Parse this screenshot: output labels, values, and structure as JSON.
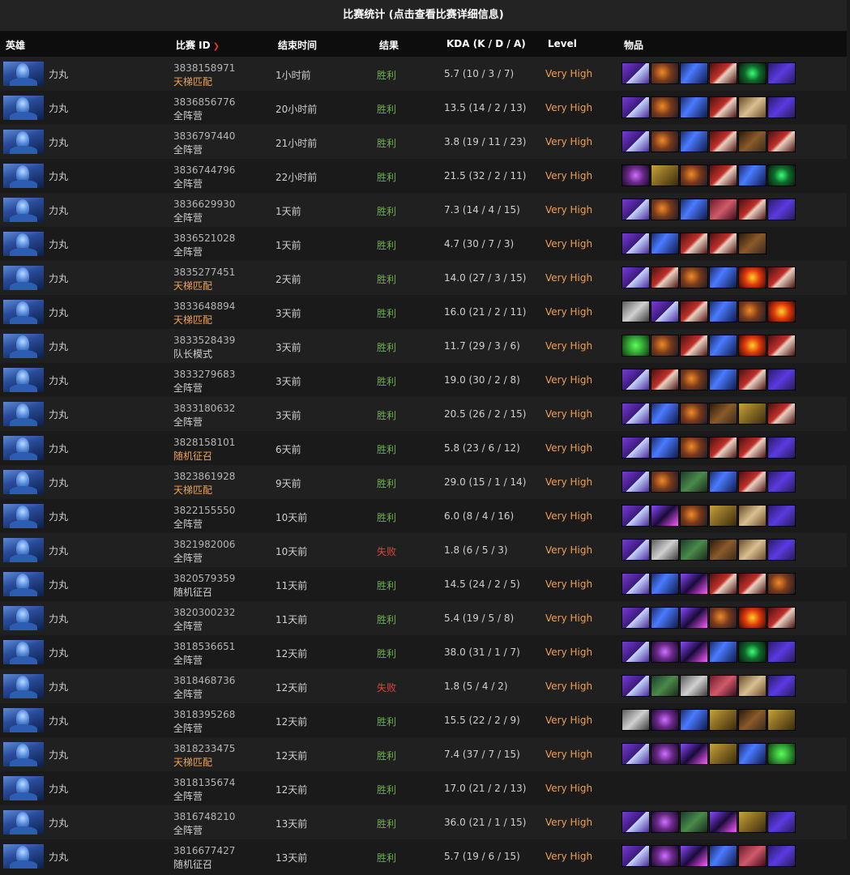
{
  "page_title": "比赛统计 (点击查看比赛详细信息)",
  "columns": {
    "hero": "英雄",
    "match_id": "比赛 ID",
    "end_time": "结束时间",
    "result": "结果",
    "kda": "KDA (K / D / A)",
    "level": "Level",
    "items": "物品"
  },
  "rows": [
    {
      "hero": "力丸",
      "match_id": "3838158971",
      "mode": "天梯匹配",
      "ranked": true,
      "end_time": "1小时前",
      "result": "胜利",
      "win": true,
      "kda": "5.7 (10 / 3 / 7)",
      "level": "Very High",
      "items": [
        "it-a",
        "it-b",
        "it-c",
        "it-d",
        "it-e",
        "it-f"
      ]
    },
    {
      "hero": "力丸",
      "match_id": "3836856776",
      "mode": "全阵营",
      "ranked": false,
      "end_time": "20小时前",
      "result": "胜利",
      "win": true,
      "kda": "13.5 (14 / 2 / 13)",
      "level": "Very High",
      "items": [
        "it-a",
        "it-b",
        "it-c",
        "it-d",
        "it-g",
        "it-f"
      ]
    },
    {
      "hero": "力丸",
      "match_id": "3836797440",
      "mode": "全阵营",
      "ranked": false,
      "end_time": "21小时前",
      "result": "胜利",
      "win": true,
      "kda": "3.8 (19 / 11 / 23)",
      "level": "Very High",
      "items": [
        "it-a",
        "it-b",
        "it-c",
        "it-d",
        "it-j",
        "it-d"
      ]
    },
    {
      "hero": "力丸",
      "match_id": "3836744796",
      "mode": "全阵营",
      "ranked": false,
      "end_time": "22小时前",
      "result": "胜利",
      "win": true,
      "kda": "21.5 (32 / 2 / 11)",
      "level": "Very High",
      "items": [
        "it-i",
        "it-l",
        "it-b",
        "it-d",
        "it-c",
        "it-e"
      ]
    },
    {
      "hero": "力丸",
      "match_id": "3836629930",
      "mode": "全阵营",
      "ranked": false,
      "end_time": "1天前",
      "result": "胜利",
      "win": true,
      "kda": "7.3 (14 / 4 / 15)",
      "level": "Very High",
      "items": [
        "it-a",
        "it-b",
        "it-c",
        "it-p",
        "it-d",
        "it-f"
      ]
    },
    {
      "hero": "力丸",
      "match_id": "3836521028",
      "mode": "全阵营",
      "ranked": false,
      "end_time": "1天前",
      "result": "胜利",
      "win": true,
      "kda": "4.7 (30 / 7 / 3)",
      "level": "Very High",
      "items": [
        "it-a",
        "it-c",
        "it-d",
        "it-d",
        "it-j"
      ]
    },
    {
      "hero": "力丸",
      "match_id": "3835277451",
      "mode": "天梯匹配",
      "ranked": true,
      "end_time": "2天前",
      "result": "胜利",
      "win": true,
      "kda": "14.0 (27 / 3 / 15)",
      "level": "Very High",
      "items": [
        "it-a",
        "it-d",
        "it-b",
        "it-c",
        "it-h",
        "it-d"
      ]
    },
    {
      "hero": "力丸",
      "match_id": "3833648894",
      "mode": "天梯匹配",
      "ranked": true,
      "end_time": "3天前",
      "result": "胜利",
      "win": true,
      "kda": "16.0 (21 / 2 / 11)",
      "level": "Very High",
      "items": [
        "it-n",
        "it-a",
        "it-d",
        "it-c",
        "it-b",
        "it-h"
      ]
    },
    {
      "hero": "力丸",
      "match_id": "3833528439",
      "mode": "队长模式",
      "ranked": false,
      "end_time": "3天前",
      "result": "胜利",
      "win": true,
      "kda": "11.7 (29 / 3 / 6)",
      "level": "Very High",
      "items": [
        "it-m",
        "it-b",
        "it-d",
        "it-c",
        "it-h",
        "it-d"
      ]
    },
    {
      "hero": "力丸",
      "match_id": "3833279683",
      "mode": "全阵营",
      "ranked": false,
      "end_time": "3天前",
      "result": "胜利",
      "win": true,
      "kda": "19.0 (30 / 2 / 8)",
      "level": "Very High",
      "items": [
        "it-a",
        "it-d",
        "it-b",
        "it-c",
        "it-d",
        "it-f"
      ]
    },
    {
      "hero": "力丸",
      "match_id": "3833180632",
      "mode": "全阵营",
      "ranked": false,
      "end_time": "3天前",
      "result": "胜利",
      "win": true,
      "kda": "20.5 (26 / 2 / 15)",
      "level": "Very High",
      "items": [
        "it-a",
        "it-c",
        "it-b",
        "it-j",
        "it-l",
        "it-d"
      ]
    },
    {
      "hero": "力丸",
      "match_id": "3828158101",
      "mode": "随机征召",
      "ranked": true,
      "end_time": "6天前",
      "result": "胜利",
      "win": true,
      "kda": "5.8 (23 / 6 / 12)",
      "level": "Very High",
      "items": [
        "it-a",
        "it-c",
        "it-b",
        "it-d",
        "it-d",
        "it-f"
      ]
    },
    {
      "hero": "力丸",
      "match_id": "3823861928",
      "mode": "天梯匹配",
      "ranked": true,
      "end_time": "9天前",
      "result": "胜利",
      "win": true,
      "kda": "29.0 (15 / 1 / 14)",
      "level": "Very High",
      "items": [
        "it-a",
        "it-b",
        "it-o",
        "it-c",
        "it-d",
        "it-f"
      ]
    },
    {
      "hero": "力丸",
      "match_id": "3822155550",
      "mode": "全阵营",
      "ranked": false,
      "end_time": "10天前",
      "result": "胜利",
      "win": true,
      "kda": "6.0 (8 / 4 / 16)",
      "level": "Very High",
      "items": [
        "it-a",
        "it-k",
        "it-b",
        "it-l",
        "it-g",
        "it-f"
      ]
    },
    {
      "hero": "力丸",
      "match_id": "3821982006",
      "mode": "全阵营",
      "ranked": false,
      "end_time": "10天前",
      "result": "失败",
      "win": false,
      "kda": "1.8 (6 / 5 / 3)",
      "level": "Very High",
      "items": [
        "it-a",
        "it-n",
        "it-o",
        "it-j",
        "it-g",
        "it-f"
      ]
    },
    {
      "hero": "力丸",
      "match_id": "3820579359",
      "mode": "随机征召",
      "ranked": false,
      "end_time": "11天前",
      "result": "胜利",
      "win": true,
      "kda": "14.5 (24 / 2 / 5)",
      "level": "Very High",
      "items": [
        "it-a",
        "it-c",
        "it-k",
        "it-d",
        "it-d",
        "it-b"
      ]
    },
    {
      "hero": "力丸",
      "match_id": "3820300232",
      "mode": "全阵营",
      "ranked": false,
      "end_time": "11天前",
      "result": "胜利",
      "win": true,
      "kda": "5.4 (19 / 5 / 8)",
      "level": "Very High",
      "items": [
        "it-a",
        "it-c",
        "it-k",
        "it-b",
        "it-h",
        "it-d"
      ]
    },
    {
      "hero": "力丸",
      "match_id": "3818536651",
      "mode": "全阵营",
      "ranked": false,
      "end_time": "12天前",
      "result": "胜利",
      "win": true,
      "kda": "38.0 (31 / 1 / 7)",
      "level": "Very High",
      "items": [
        "it-a",
        "it-i",
        "it-k",
        "it-c",
        "it-e",
        "it-f"
      ]
    },
    {
      "hero": "力丸",
      "match_id": "3818468736",
      "mode": "全阵营",
      "ranked": false,
      "end_time": "12天前",
      "result": "失败",
      "win": false,
      "kda": "1.8 (5 / 4 / 2)",
      "level": "Very High",
      "items": [
        "it-a",
        "it-o",
        "it-n",
        "it-p",
        "it-g",
        "it-f"
      ]
    },
    {
      "hero": "力丸",
      "match_id": "3818395268",
      "mode": "全阵营",
      "ranked": false,
      "end_time": "12天前",
      "result": "胜利",
      "win": true,
      "kda": "15.5 (22 / 2 / 9)",
      "level": "Very High",
      "items": [
        "it-n",
        "it-i",
        "it-c",
        "it-l",
        "it-j",
        "it-l"
      ]
    },
    {
      "hero": "力丸",
      "match_id": "3818233475",
      "mode": "天梯匹配",
      "ranked": true,
      "end_time": "12天前",
      "result": "胜利",
      "win": true,
      "kda": "7.4 (37 / 7 / 15)",
      "level": "Very High",
      "items": [
        "it-a",
        "it-i",
        "it-k",
        "it-l",
        "it-c",
        "it-m"
      ]
    },
    {
      "hero": "力丸",
      "match_id": "3818135674",
      "mode": "全阵营",
      "ranked": false,
      "end_time": "12天前",
      "result": "胜利",
      "win": true,
      "kda": "17.0 (21 / 2 / 13)",
      "level": "Very High",
      "items": []
    },
    {
      "hero": "力丸",
      "match_id": "3816748210",
      "mode": "全阵营",
      "ranked": false,
      "end_time": "13天前",
      "result": "胜利",
      "win": true,
      "kda": "36.0 (21 / 1 / 15)",
      "level": "Very High",
      "items": [
        "it-a",
        "it-i",
        "it-o",
        "it-k",
        "it-l",
        "it-f"
      ]
    },
    {
      "hero": "力丸",
      "match_id": "3816677427",
      "mode": "随机征召",
      "ranked": false,
      "end_time": "13天前",
      "result": "胜利",
      "win": true,
      "kda": "5.7 (19 / 6 / 15)",
      "level": "Very High",
      "items": [
        "it-a",
        "it-i",
        "it-k",
        "it-c",
        "it-p",
        "it-f"
      ]
    }
  ]
}
